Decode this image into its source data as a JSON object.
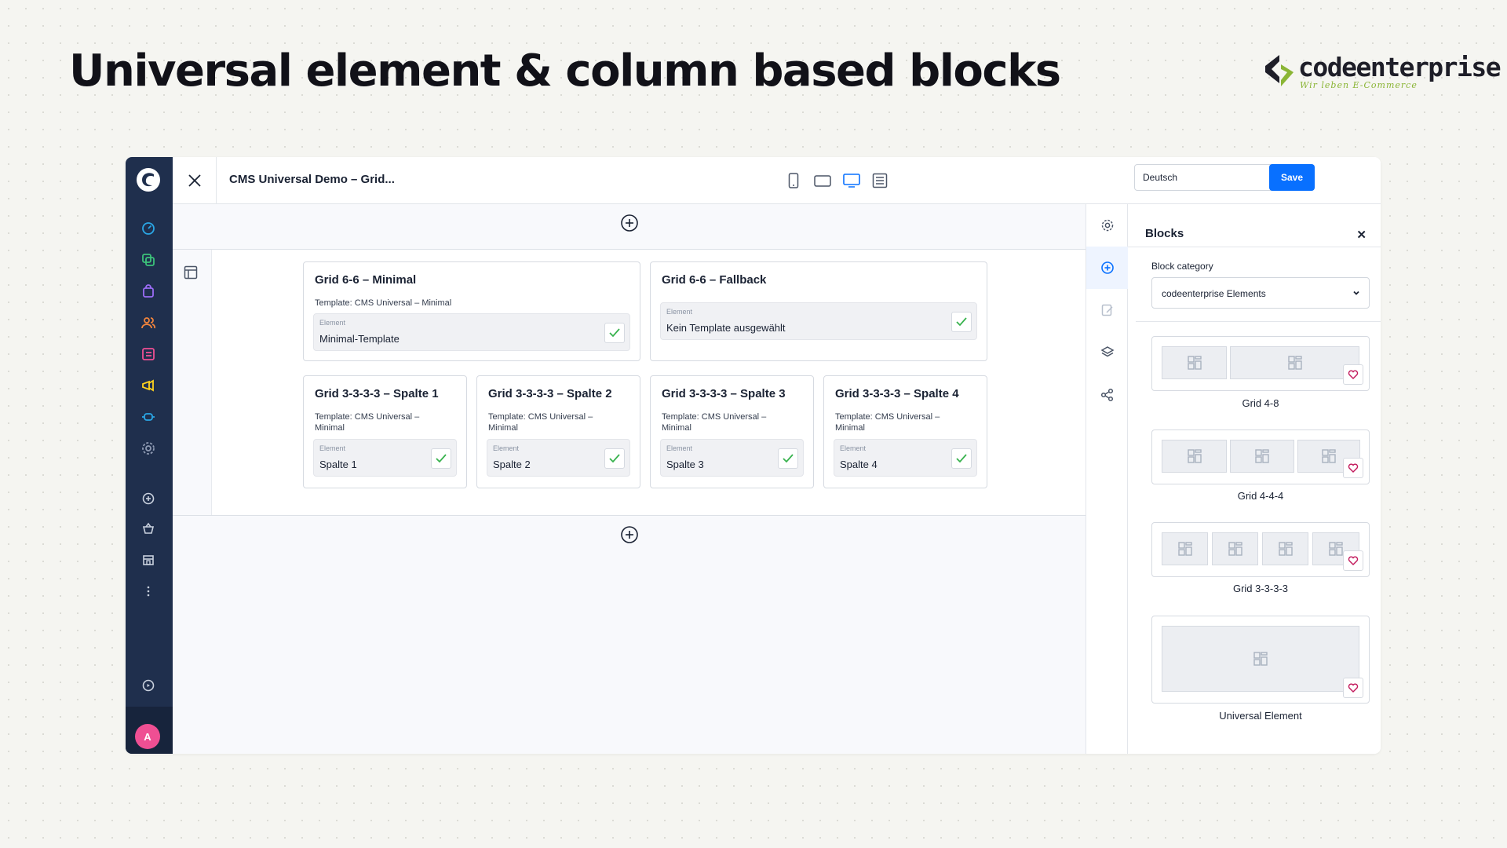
{
  "slide": {
    "title": "Universal element & column based blocks",
    "brand_name": "codeenterprise",
    "brand_tagline": "Wir leben E-Commerce"
  },
  "colors": {
    "nav_bg": "#1f2f4d",
    "primary": "#0870ff",
    "avatar": "#ef4f93",
    "check": "#37b24d",
    "heart": "#c2185b"
  },
  "nav": {
    "icons": [
      "dashboard-icon",
      "catalogue-icon",
      "orders-icon",
      "customers-icon",
      "content-icon",
      "marketing-icon",
      "extensions-icon",
      "settings-icon",
      "add-icon",
      "basket-icon",
      "store-icon",
      "more-icon",
      "help-icon"
    ],
    "avatar_initial": "A"
  },
  "topbar": {
    "page_name": "CMS Universal Demo – Grid...",
    "devices": [
      "mobile-icon",
      "tablet-icon",
      "desktop-icon",
      "list-view-icon"
    ],
    "language": "Deutsch",
    "save_label": "Save"
  },
  "cards": [
    {
      "title": "Grid 6-6 – Minimal",
      "template": "Template: CMS Universal – Minimal",
      "element_label": "Element",
      "element_value": "Minimal-Template"
    },
    {
      "title": "Grid 6-6 – Fallback",
      "template": "",
      "element_label": "Element",
      "element_value": "Kein Template ausgewählt"
    },
    {
      "title": "Grid 3-3-3-3 – Spalte 1",
      "template": "Template: CMS Universal – Minimal",
      "element_label": "Element",
      "element_value": "Spalte 1"
    },
    {
      "title": "Grid 3-3-3-3 – Spalte 2",
      "template": "Template: CMS Universal – Minimal",
      "element_label": "Element",
      "element_value": "Spalte 2"
    },
    {
      "title": "Grid 3-3-3-3 – Spalte 3",
      "template": "Template: CMS Universal – Minimal",
      "element_label": "Element",
      "element_value": "Spalte 3"
    },
    {
      "title": "Grid 3-3-3-3 – Spalte 4",
      "template": "Template: CMS Universal – Minimal",
      "element_label": "Element",
      "element_value": "Spalte 4"
    }
  ],
  "sidebar_tabs": [
    "settings-icon",
    "add-block-icon",
    "edit-icon",
    "layers-icon",
    "share-icon"
  ],
  "blocks_panel": {
    "title": "Blocks",
    "category_label": "Block category",
    "category_value": "codeenterprise Elements",
    "blocks": [
      {
        "name": "Grid 4-8"
      },
      {
        "name": "Grid 4-4-4"
      },
      {
        "name": "Grid 3-3-3-3"
      },
      {
        "name": "Universal Element"
      }
    ]
  }
}
